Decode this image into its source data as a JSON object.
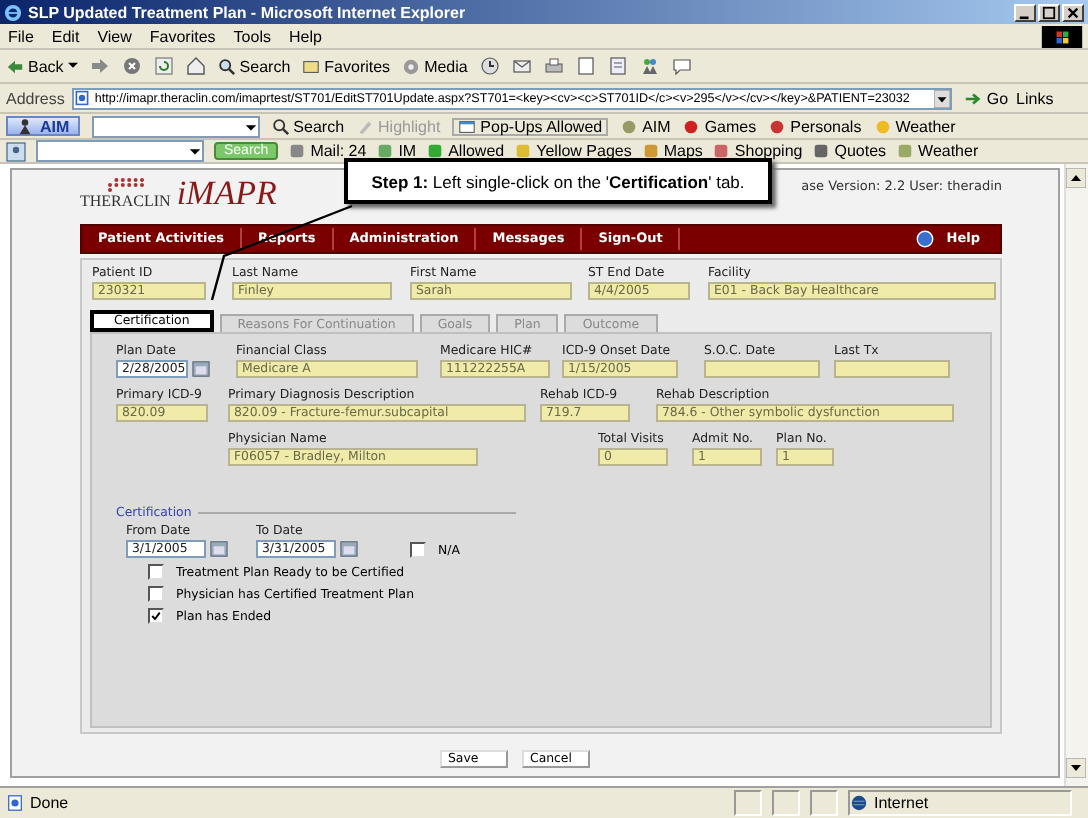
{
  "window": {
    "title": "SLP Updated Treatment Plan - Microsoft Internet Explorer"
  },
  "menu": [
    "File",
    "Edit",
    "View",
    "Favorites",
    "Tools",
    "Help"
  ],
  "toolbar": {
    "back": "Back",
    "buttons": [
      "Search",
      "Favorites",
      "Media"
    ]
  },
  "address": {
    "label": "Address",
    "url": "http://imapr.theraclin.com/imaprtest/ST701/EditST701Update.aspx?ST701=<key><cv><c>ST701ID</c><v>295</v></cv></key>&PATIENT=23032",
    "go": "Go",
    "links": "Links"
  },
  "aim_toolbar": {
    "brand": "AIM",
    "search": "Search",
    "highlight": "Highlight",
    "popups": "Pop-Ups Allowed",
    "items": [
      "AIM",
      "Games",
      "Personals",
      "Weather"
    ]
  },
  "search_toolbar": {
    "search": "Search",
    "items": [
      "Mail: 24",
      "IM",
      "Allowed",
      "Yellow Pages",
      "Maps",
      "Shopping",
      "Quotes",
      "Weather"
    ]
  },
  "app": {
    "brand": "THERACLIN",
    "product": "iMAPR",
    "session": "ase Version: 2.2 User: theradin",
    "nav": [
      "Patient Activities",
      "Reports",
      "Administration",
      "Messages",
      "Sign-Out"
    ],
    "help": "Help"
  },
  "patient": [
    {
      "label": "Patient ID",
      "value": "230321"
    },
    {
      "label": "Last Name",
      "value": "Finley"
    },
    {
      "label": "First Name",
      "value": "Sarah"
    },
    {
      "label": "ST End Date",
      "value": "4/4/2005"
    },
    {
      "label": "Facility",
      "value": "E01 - Back Bay Healthcare"
    }
  ],
  "tabs": [
    {
      "label": "Certification",
      "selected": true
    },
    {
      "label": "Reasons For Continuation",
      "selected": false
    },
    {
      "label": "Goals",
      "selected": false
    },
    {
      "label": "Plan",
      "selected": false
    },
    {
      "label": "Outcome",
      "selected": false
    }
  ],
  "form_rows": [
    [
      {
        "label": "Plan Date",
        "value": "2/28/2005",
        "kind": "date"
      },
      {
        "label": "Financial Class",
        "value": "Medicare A",
        "kind": "text"
      },
      {
        "label": "Medicare HIC#",
        "value": "111222255A",
        "kind": "text"
      },
      {
        "label": "ICD-9 Onset Date",
        "value": "1/15/2005",
        "kind": "text"
      },
      {
        "label": "S.O.C. Date",
        "kind": "text"
      },
      {
        "label": "Last Tx",
        "kind": "text"
      }
    ],
    [
      {
        "label": "Primary ICD-9",
        "value": "820.09",
        "kind": "text"
      },
      {
        "label": "Primary Diagnosis Description",
        "value": "820.09 - Fracture-femur.subcapital",
        "kind": "text"
      },
      {
        "label": "Rehab ICD-9",
        "value": "719.7",
        "kind": "text"
      },
      {
        "label": "Rehab Description",
        "value": "784.6 - Other symbolic dysfunction",
        "kind": "text"
      }
    ],
    [
      {
        "label": "Physician Name",
        "value": "F06057 - Bradley, Milton",
        "kind": "text"
      },
      {
        "label": "Total Visits",
        "value": "0",
        "kind": "text"
      },
      {
        "label": "Admit No.",
        "value": "1",
        "kind": "text"
      },
      {
        "label": "Plan No.",
        "value": "1",
        "kind": "text"
      }
    ]
  ],
  "certification": {
    "title": "Certification",
    "from": {
      "label": "From Date",
      "value": "3/1/2005"
    },
    "to": {
      "label": "To Date",
      "value": "3/31/2005"
    },
    "na": {
      "label": "N/A",
      "checked": false
    },
    "checks": [
      {
        "label": "Treatment Plan Ready to be Certified",
        "checked": false
      },
      {
        "label": "Physician has Certified Treatment Plan",
        "checked": false
      },
      {
        "label": "Plan has Ended",
        "checked": true
      }
    ]
  },
  "buttons": [
    "Save",
    "Cancel"
  ],
  "status": {
    "text": "Done",
    "zone": "Internet"
  },
  "callout": {
    "text": "**Step 1:** Left single-click on the '**Certification**' tab."
  }
}
